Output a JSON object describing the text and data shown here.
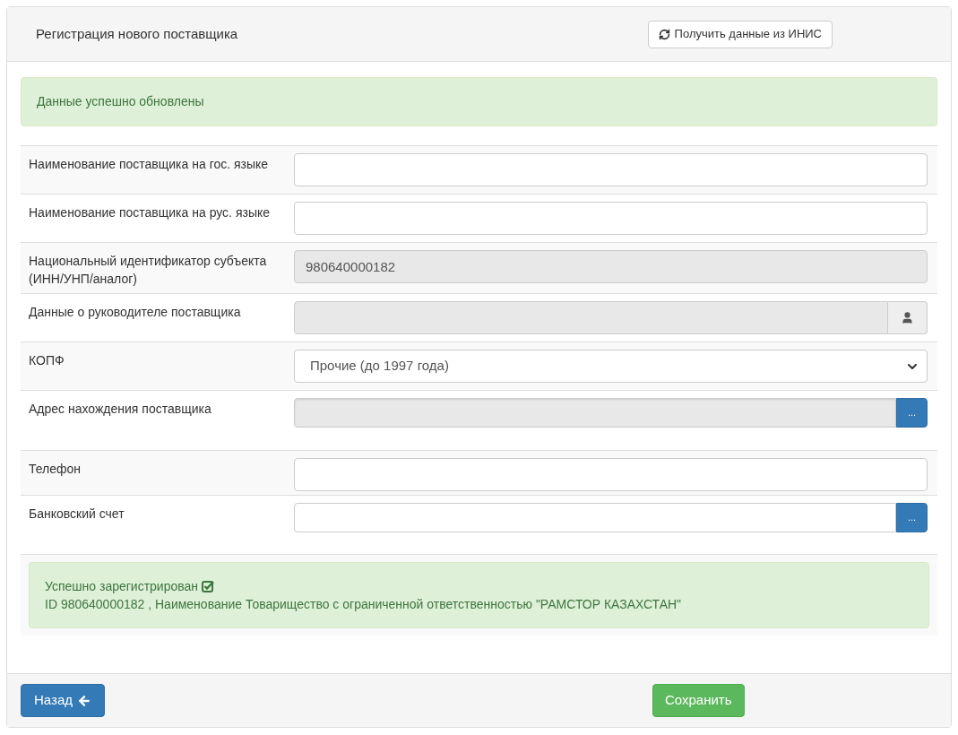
{
  "panel": {
    "title": "Регистрация нового поставщика",
    "fetch_button": "Получить данные из ИНИС"
  },
  "alert": {
    "text": "Данные успешно обновлены"
  },
  "fields": [
    {
      "label": "Наименование поставщика на гос. языке",
      "kind": "input",
      "disabled": false
    },
    {
      "label": "Наименование поставщика на рус. языке",
      "kind": "input",
      "disabled": false
    },
    {
      "label": "Национальный идентификатор субъекта (ИНН/УНП/аналог)",
      "kind": "input",
      "disabled": true,
      "value": "980640000182"
    },
    {
      "label": "Данные о руководителе поставщика",
      "kind": "input-person",
      "disabled": true
    },
    {
      "label": "КОПФ",
      "kind": "select",
      "disabled": false,
      "value": "Прочие (до 1997 года)"
    },
    {
      "label": "Адрес нахождения поставщика",
      "kind": "input-dots",
      "disabled": true,
      "addon_label": "..."
    },
    {
      "label": "Телефон",
      "kind": "input",
      "disabled": false
    },
    {
      "label": "Банковский счет",
      "kind": "input-dots",
      "disabled": false,
      "addon_label": "..."
    }
  ],
  "success": {
    "title": "Успешно зарегистрирован",
    "details": "ID 980640000182 , Наименование Товарищество с ограниченной ответственностью \"РАМСТОР КАЗАХСТАН\""
  },
  "footer": {
    "back_button": "Назад",
    "save_button": "Сохранить"
  }
}
